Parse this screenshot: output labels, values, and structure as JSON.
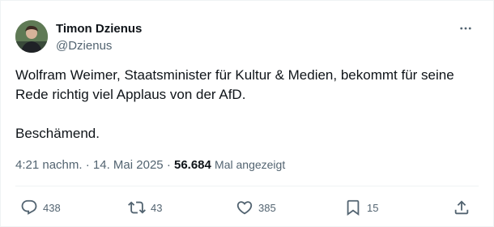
{
  "author": {
    "name": "Timon Dzienus",
    "handle": "@Dzienus"
  },
  "tweet": {
    "paragraphs": [
      "Wolfram Weimer, Staatsminister für Kultur & Medien, bekommt für seine Rede richtig viel Applaus von der AfD.",
      "Beschämend."
    ],
    "time": "4:21 nachm.",
    "sep1": "·",
    "date": "14. Mai 2025",
    "sep2": "·",
    "views_count": "56.684",
    "views_label": "Mal angezeigt"
  },
  "actions": {
    "replies": "438",
    "reposts": "43",
    "likes": "385",
    "bookmarks": "15"
  },
  "icons": {
    "more": "more-dots-icon",
    "reply": "reply-icon",
    "repost": "repost-icon",
    "like": "heart-icon",
    "bookmark": "bookmark-icon",
    "share": "share-icon"
  },
  "colors": {
    "text": "#0f1419",
    "secondary": "#536471",
    "divider": "#eff3f4"
  }
}
